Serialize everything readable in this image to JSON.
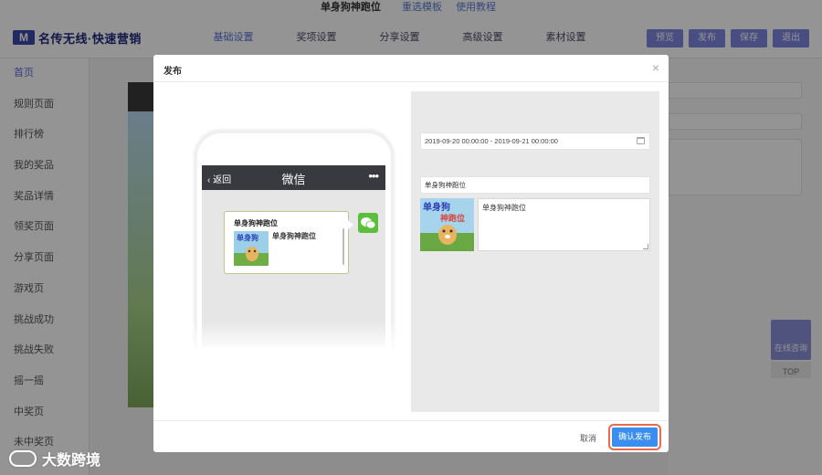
{
  "top": {
    "title": "单身狗神跑位",
    "links": [
      "重选模板",
      "使用教程"
    ]
  },
  "header": {
    "logo_mark": "M",
    "logo_text": "名传无线·快速营销",
    "tabs": [
      {
        "label": "基础设置",
        "active": true
      },
      {
        "label": "奖项设置"
      },
      {
        "label": "分享设置"
      },
      {
        "label": "高级设置"
      },
      {
        "label": "素材设置"
      }
    ],
    "buttons": [
      "预览",
      "发布",
      "保存",
      "退出"
    ]
  },
  "sidebar": {
    "items": [
      "首页",
      "规则页面",
      "排行榜",
      "我的奖品",
      "奖品详情",
      "领奖页面",
      "分享页面",
      "游戏页",
      "挑战成功",
      "挑战失败",
      "摇一摇",
      "中奖页",
      "未中奖页"
    ]
  },
  "floating": {
    "consult": "在线咨询",
    "top": "TOP"
  },
  "watermark": {
    "text": "大数跨境"
  },
  "modal": {
    "title": "发布",
    "close_glyph": "×",
    "cancel_label": "取消",
    "confirm_label": "确认发布",
    "phone": {
      "back_label": "返回",
      "nav_title": "微信",
      "more_glyph": "•••",
      "share_title": "单身狗神跑位",
      "share_desc": "单身狗神跑位"
    },
    "form": {
      "date_range": "2019-09-20 00:00:00 - 2019-09-21 00:00:00",
      "share_title_value": "单身狗神跑位",
      "share_desc_value": "单身狗神跑位"
    }
  },
  "colors": {
    "accent": "#5b6fd8",
    "confirm_button": "#3a8ef0",
    "confirm_highlight": "#ec6a4c",
    "wechat_green": "#5bbf3c"
  }
}
